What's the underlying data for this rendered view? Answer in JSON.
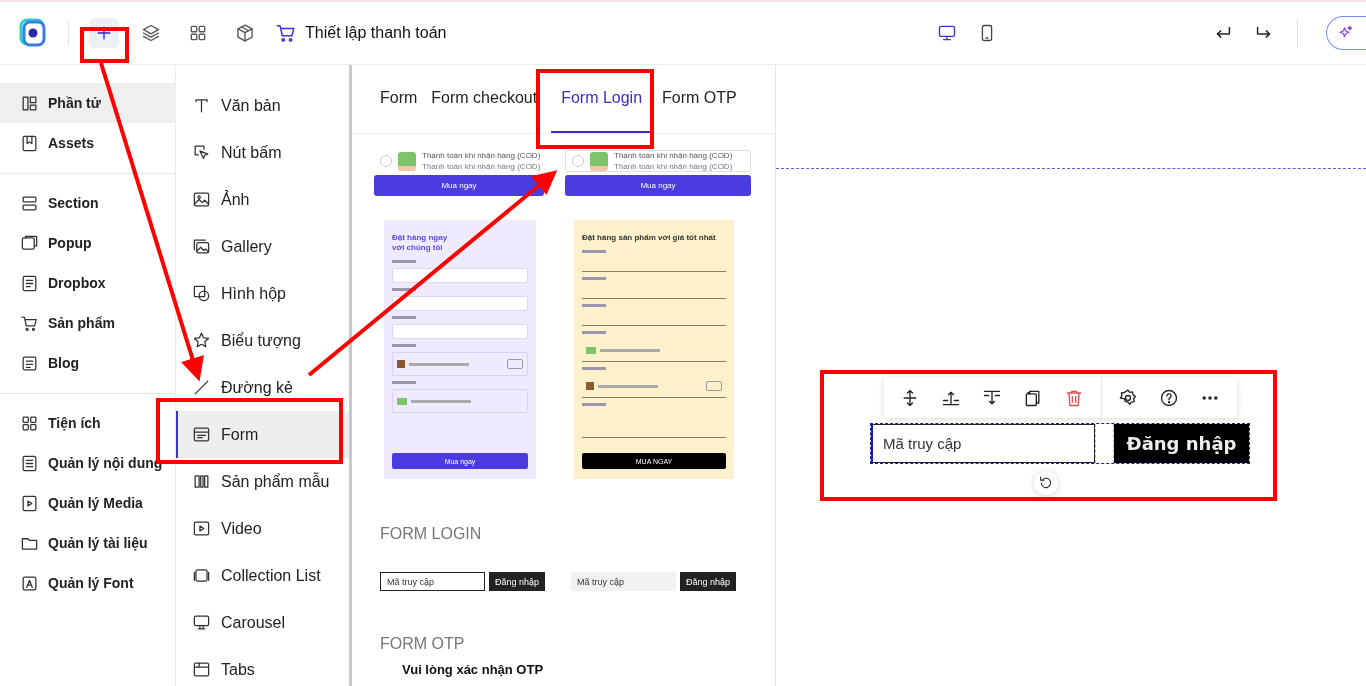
{
  "toolbar": {
    "tools": [
      {
        "kind": "add",
        "selected": true
      },
      {
        "kind": "layers",
        "selected": false
      },
      {
        "kind": "grid",
        "selected": false
      },
      {
        "kind": "box",
        "selected": false
      }
    ],
    "checkout_link": "Thiết lập thanh toán",
    "devices": [
      {
        "kind": "desktop",
        "selected": true
      },
      {
        "kind": "mobile",
        "selected": false
      }
    ]
  },
  "sidebar": {
    "groups": [
      {
        "items": [
          {
            "label": "Phần tử",
            "kind": "elements",
            "selected": true
          },
          {
            "label": "Assets",
            "kind": "assets",
            "selected": false
          }
        ]
      },
      {
        "items": [
          {
            "label": "Section",
            "kind": "section",
            "selected": false
          },
          {
            "label": "Popup",
            "kind": "popup",
            "selected": false
          },
          {
            "label": "Dropbox",
            "kind": "dropbox",
            "selected": false
          },
          {
            "label": "Sản phẩm",
            "kind": "cart",
            "selected": false
          },
          {
            "label": "Blog",
            "kind": "blog",
            "selected": false
          }
        ]
      },
      {
        "items": [
          {
            "label": "Tiện ích",
            "kind": "grid",
            "selected": false
          },
          {
            "label": "Quản lý nội dung",
            "kind": "content",
            "selected": false
          },
          {
            "label": "Quản lý Media",
            "kind": "media",
            "selected": false
          },
          {
            "label": "Quản lý tài liệu",
            "kind": "folder",
            "selected": false
          },
          {
            "label": "Quản lý Font",
            "kind": "font",
            "selected": false
          }
        ]
      }
    ]
  },
  "elements": [
    {
      "label": "Văn bản",
      "kind": "text",
      "selected": false
    },
    {
      "label": "Nút bấm",
      "kind": "pointer",
      "selected": false
    },
    {
      "label": "Ảnh",
      "kind": "image",
      "selected": false
    },
    {
      "label": "Gallery",
      "kind": "gallery",
      "selected": false
    },
    {
      "label": "Hình hộp",
      "kind": "cube",
      "selected": false
    },
    {
      "label": "Biểu tượng",
      "kind": "star",
      "selected": false
    },
    {
      "label": "Đường kẻ",
      "kind": "line",
      "selected": false
    },
    {
      "label": "Form",
      "kind": "form",
      "selected": true
    },
    {
      "label": "Sản phẩm mẫu",
      "kind": "product",
      "selected": false
    },
    {
      "label": "Video",
      "kind": "video",
      "selected": false
    },
    {
      "label": "Collection List",
      "kind": "collection",
      "selected": false
    },
    {
      "label": "Carousel",
      "kind": "carousel",
      "selected": false
    },
    {
      "label": "Tabs",
      "kind": "tabs",
      "selected": false
    }
  ],
  "panel": {
    "tabs": [
      {
        "label": "Form",
        "selected": false
      },
      {
        "label": "Form checkout",
        "selected": false
      },
      {
        "label": "Form Login",
        "selected": true
      },
      {
        "label": "Form OTP",
        "selected": false
      }
    ],
    "payment_cards": [
      {
        "title": "Thanh toán khi nhận hàng (COD)",
        "subtitle": "Thanh toán khi nhận hàng (COD)",
        "selected": false
      },
      {
        "title": "Thanh toán khi nhận hàng (COD)",
        "subtitle": "Thanh toán khi nhận hàng (COD)",
        "selected": true
      }
    ],
    "buy_buttons": [
      "Mua ngay",
      "Mua ngay"
    ],
    "form_cards": [
      {
        "title": "Đặt hàng ngay với chúng tôi",
        "button": "Mua ngay"
      },
      {
        "title": "Đặt hàng sản phẩm với giá tốt nhất",
        "button": "MUA NGAY"
      }
    ],
    "login_heading": "FORM LOGIN",
    "login_variants": [
      {
        "placeholder": "Mã truy cập",
        "button": "Đăng nhập"
      },
      {
        "placeholder": "Mã truy cập",
        "button": "Đăng nhập"
      }
    ],
    "otp_heading": "FORM OTP",
    "otp_prompt": "Vui lòng xác nhận OTP"
  },
  "canvas": {
    "actions": [
      {
        "kind": "move"
      },
      {
        "kind": "insert-above"
      },
      {
        "kind": "insert-below"
      },
      {
        "kind": "duplicate"
      },
      {
        "kind": "delete"
      },
      {
        "kind": "settings"
      },
      {
        "kind": "help"
      },
      {
        "kind": "more"
      }
    ],
    "login": {
      "placeholder": "Mã truy cập",
      "button": "Đăng nhập"
    }
  }
}
